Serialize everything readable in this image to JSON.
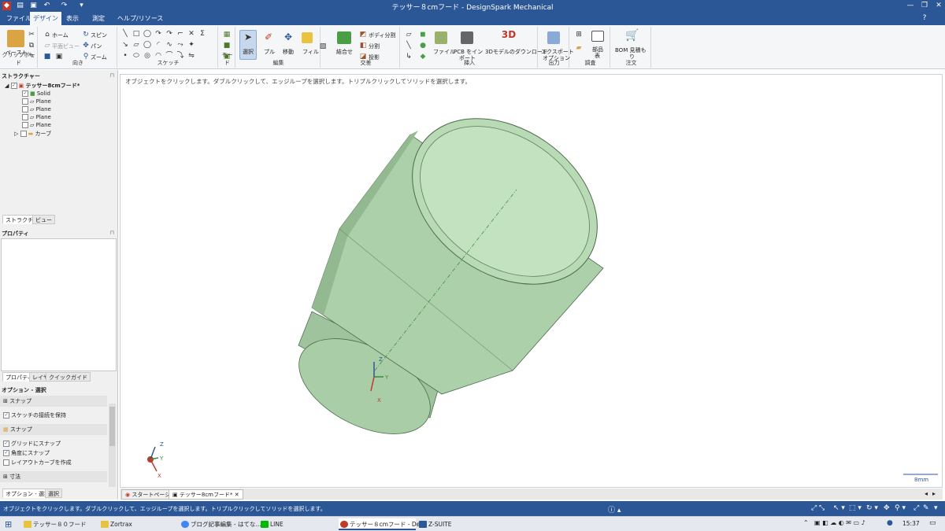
{
  "window": {
    "title": "テッサー８cmフード - DesignSpark Mechanical",
    "minimize": "—",
    "restore": "❐",
    "close": "✕"
  },
  "menu": {
    "tabs": [
      "ファイル",
      "デザイン",
      "表示",
      "測定",
      "ヘルプ/リソース"
    ],
    "active": "デザイン"
  },
  "ribbon": {
    "clipboard": {
      "paste": "ペースト",
      "label": "クリップボード"
    },
    "orient": {
      "home": "ホーム",
      "plane_view": "平面ビュー",
      "spin": "スピン",
      "pan": "パン",
      "zoom": "ズーム",
      "label": "向き"
    },
    "sketch": {
      "label": "スケッチ"
    },
    "mode": {
      "label": "モード"
    },
    "edit": {
      "select": "選択",
      "pull": "プル",
      "move": "移動",
      "fill": "フィル",
      "label": "編集"
    },
    "intersect": {
      "combine": "結合せ",
      "split_body": "ボディ分割",
      "split": "分割",
      "project": "投影",
      "label": "交差"
    },
    "insert": {
      "file": "ファイル",
      "pcb": "PCB をイン",
      "pcb2": "ポート",
      "model3d": "3Dモデルのダウンロード",
      "label": "挿入"
    },
    "output": {
      "export": "エクスポート",
      "options": "オプション",
      "label": "出力"
    },
    "investigate": {
      "parts": "部品",
      "table": "表",
      "label": "調査"
    },
    "order": {
      "bom": "BOM 見積も",
      "bom2": "り",
      "label": "注文"
    }
  },
  "structure": {
    "header": "ストラクチャー",
    "root": "テッサー8cmフード*",
    "items": [
      "Solid",
      "Plane",
      "Plane",
      "Plane",
      "Plane",
      "カーブ"
    ],
    "tabs": [
      "ストラクチャー",
      "ビュー"
    ]
  },
  "properties": {
    "header": "プロパティ",
    "tabs": [
      "プロパティ",
      "レイヤ",
      "クイックガイド"
    ]
  },
  "options": {
    "header": "オプション - 選択",
    "sections": [
      "スナップ",
      "スナップ",
      "寸法"
    ],
    "rows": [
      "スケッチの接続を保持",
      "グリッドにスナップ",
      "角度にスナップ",
      "レイアウトカーブを作成"
    ],
    "checked": [
      true,
      true,
      true,
      false
    ]
  },
  "left_bottom_tabs": [
    "オプション - 選択",
    "選択"
  ],
  "viewport": {
    "hint": "オブジェクトをクリックします。ダブルクリックして、エッジループを選択します。トリプルクリックしてソリッドを選択します。",
    "scale_label": "8mm",
    "axes": {
      "x": "X",
      "y": "Y",
      "z": "Z"
    }
  },
  "doc_tabs": [
    "スタートページ",
    "テッサー8cmフード*"
  ],
  "status": {
    "message": "オブジェクトをクリックします。ダブルクリックして、エッジループを選択します。トリプルクリックしてソリッドを選択します。"
  },
  "taskbar": {
    "items": [
      "テッサー８０フード",
      "Zortrax",
      "ブログ記事編集 - はてな...",
      "LINE",
      "テッサー８cmフード - De...",
      "Z-SUITE"
    ],
    "time": "15:37"
  }
}
